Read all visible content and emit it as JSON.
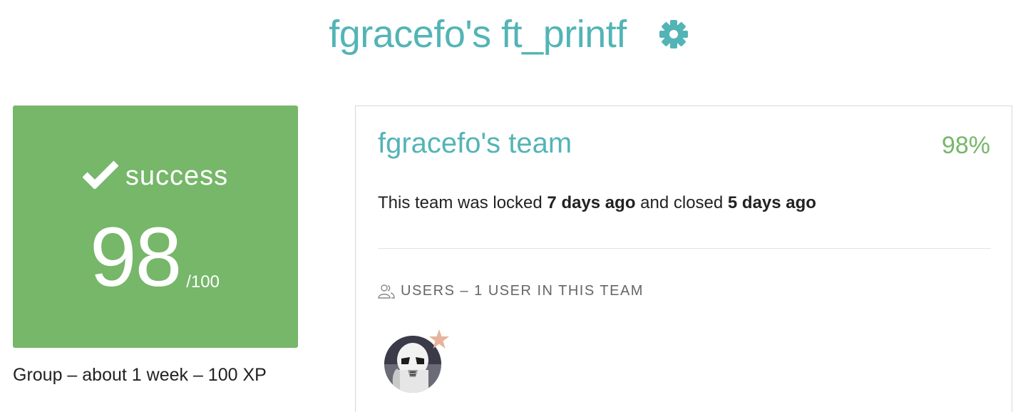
{
  "header": {
    "title": "fgracefo's ft_printf",
    "settings_icon": "gear-icon"
  },
  "score_card": {
    "status": "success",
    "status_icon": "check-icon",
    "score": "98",
    "max": "/100",
    "background_color": "#76b769"
  },
  "meta": {
    "text": "Group – about 1 week – 100 XP"
  },
  "team": {
    "name": "fgracefo's team",
    "percent": "98%",
    "lock_prefix": "This team was locked ",
    "locked_ago": "7 days ago",
    "lock_middle": " and closed ",
    "closed_ago": "5 days ago",
    "users_header": "USERS – 1 USER IN THIS TEAM",
    "users_icon": "users-icon",
    "members": [
      {
        "avatar_icon": "stormtrooper-avatar",
        "leader_badge_icon": "star-icon"
      }
    ]
  },
  "colors": {
    "accent": "#53b4b6",
    "success": "#76b769",
    "star": "#e6b49a"
  }
}
